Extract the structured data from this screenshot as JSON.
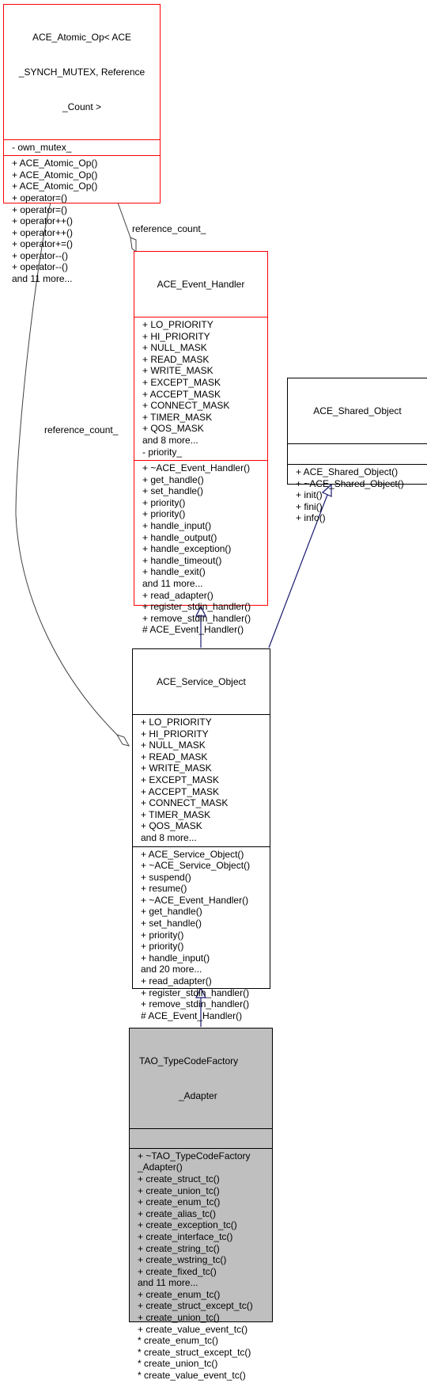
{
  "diagram": {
    "type": "class-collaboration-diagram",
    "classes": {
      "atomic_op": {
        "title_lines": [
          "ACE_Atomic_Op< ACE",
          "_SYNCH_MUTEX, Reference",
          "_Count >"
        ],
        "attributes": [
          "- own_mutex_"
        ],
        "methods": [
          "+ ACE_Atomic_Op()",
          "+ ACE_Atomic_Op()",
          "+ ACE_Atomic_Op()",
          "+ operator=()",
          "+ operator=()",
          "+ operator++()",
          "+ operator++()",
          "+ operator+=()",
          "+ operator--()",
          "+ operator--()",
          "and 11 more..."
        ],
        "border_color": "#ff0000"
      },
      "event_handler": {
        "title_lines": [
          "ACE_Event_Handler"
        ],
        "attributes": [
          "+ LO_PRIORITY",
          "+ HI_PRIORITY",
          "+ NULL_MASK",
          "+ READ_MASK",
          "+ WRITE_MASK",
          "+ EXCEPT_MASK",
          "+ ACCEPT_MASK",
          "+ CONNECT_MASK",
          "+ TIMER_MASK",
          "+ QOS_MASK",
          "and 8 more...",
          "- priority_"
        ],
        "methods": [
          "+ ~ACE_Event_Handler()",
          "+ get_handle()",
          "+ set_handle()",
          "+ priority()",
          "+ priority()",
          "+ handle_input()",
          "+ handle_output()",
          "+ handle_exception()",
          "+ handle_timeout()",
          "+ handle_exit()",
          "and 11 more...",
          "+ read_adapter()",
          "+ register_stdin_handler()",
          "+ remove_stdin_handler()",
          "# ACE_Event_Handler()"
        ],
        "border_color": "#ff0000"
      },
      "shared_object": {
        "title_lines": [
          "ACE_Shared_Object"
        ],
        "attributes": [],
        "methods": [
          "+ ACE_Shared_Object()",
          "+ ~ACE_Shared_Object()",
          "+ init()",
          "+ fini()",
          "+ info()"
        ],
        "border_color": "#000000"
      },
      "service_object": {
        "title_lines": [
          "ACE_Service_Object"
        ],
        "attributes": [
          "+ LO_PRIORITY",
          "+ HI_PRIORITY",
          "+ NULL_MASK",
          "+ READ_MASK",
          "+ WRITE_MASK",
          "+ EXCEPT_MASK",
          "+ ACCEPT_MASK",
          "+ CONNECT_MASK",
          "+ TIMER_MASK",
          "+ QOS_MASK",
          "and 8 more..."
        ],
        "methods": [
          "+ ACE_Service_Object()",
          "+ ~ACE_Service_Object()",
          "+ suspend()",
          "+ resume()",
          "+ ~ACE_Event_Handler()",
          "+ get_handle()",
          "+ set_handle()",
          "+ priority()",
          "+ priority()",
          "+ handle_input()",
          "and 20 more...",
          "+ read_adapter()",
          "+ register_stdin_handler()",
          "+ remove_stdin_handler()",
          "# ACE_Event_Handler()"
        ],
        "border_color": "#000000"
      },
      "tc_factory_adapter": {
        "title_lines": [
          "TAO_TypeCodeFactory",
          "_Adapter"
        ],
        "attributes": [],
        "methods": [
          "+ ~TAO_TypeCodeFactory",
          "_Adapter()",
          "+ create_struct_tc()",
          "+ create_union_tc()",
          "+ create_enum_tc()",
          "+ create_alias_tc()",
          "+ create_exception_tc()",
          "+ create_interface_tc()",
          "+ create_string_tc()",
          "+ create_wstring_tc()",
          "+ create_fixed_tc()",
          "and 11 more...",
          "+ create_enum_tc()",
          "+ create_struct_except_tc()",
          "+ create_union_tc()",
          "+ create_value_event_tc()",
          "* create_enum_tc()",
          "* create_struct_except_tc()",
          "* create_union_tc()",
          "* create_value_event_tc()"
        ],
        "fill_color": "#bfbfbf"
      }
    },
    "edges": {
      "ref_count_to_event_handler": {
        "label": "reference_count_",
        "kind": "aggregation",
        "color": "#404040"
      },
      "ref_count_to_service_object": {
        "label": "reference_count_",
        "kind": "aggregation",
        "color": "#404040"
      },
      "inherit_event_handler": {
        "kind": "inheritance",
        "color": "#191970"
      },
      "inherit_shared_object": {
        "kind": "inheritance",
        "color": "#191970"
      },
      "inherit_service_object": {
        "kind": "inheritance",
        "color": "#191970"
      }
    }
  }
}
